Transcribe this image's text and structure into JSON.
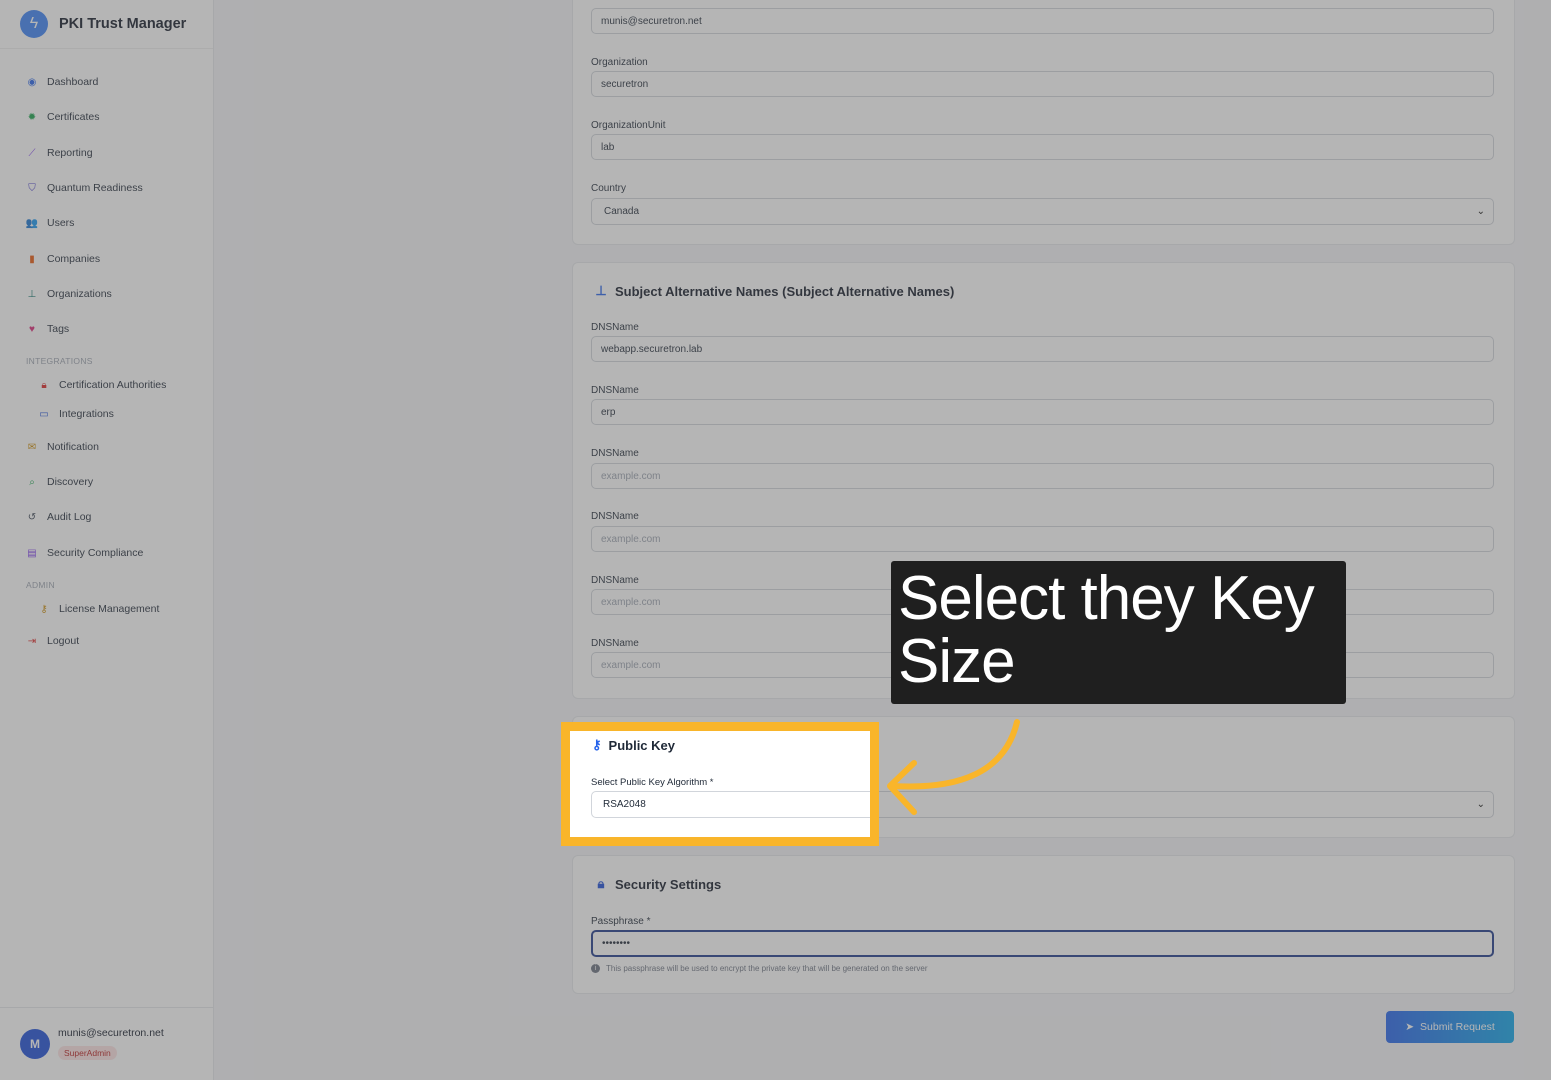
{
  "app": {
    "name": "PKI Trust Manager"
  },
  "sidebar": {
    "items": [
      {
        "label": "Dashboard",
        "icon": "dashboard-icon"
      },
      {
        "label": "Certificates",
        "icon": "certificate-icon"
      },
      {
        "label": "Reporting",
        "icon": "chart-icon"
      },
      {
        "label": "Quantum Readiness",
        "icon": "shield-icon"
      },
      {
        "label": "Users",
        "icon": "users-icon"
      },
      {
        "label": "Companies",
        "icon": "building-icon"
      },
      {
        "label": "Organizations",
        "icon": "sitemap-icon"
      },
      {
        "label": "Tags",
        "icon": "tag-icon"
      }
    ],
    "integrations_label": "INTEGRATIONS",
    "integrations": [
      {
        "label": "Certification Authorities",
        "icon": "lock-icon"
      },
      {
        "label": "Integrations",
        "icon": "laptop-icon"
      }
    ],
    "more_items": [
      {
        "label": "Notification",
        "icon": "envelope-icon"
      },
      {
        "label": "Discovery",
        "icon": "search-icon"
      },
      {
        "label": "Audit Log",
        "icon": "history-icon"
      },
      {
        "label": "Security Compliance",
        "icon": "clipboard-icon"
      }
    ],
    "admin_label": "ADMIN",
    "admin": [
      {
        "label": "License Management",
        "icon": "key-icon"
      }
    ],
    "logout": {
      "label": "Logout",
      "icon": "logout-icon"
    }
  },
  "user": {
    "initial": "M",
    "email": "munis@securetron.net",
    "role": "SuperAdmin"
  },
  "subject": {
    "email_value": "munis@securetron.net",
    "organization_label": "Organization",
    "organization_value": "securetron",
    "org_unit_label": "OrganizationUnit",
    "org_unit_value": "lab",
    "country_label": "Country",
    "country_value": "Canada"
  },
  "san": {
    "title": "Subject Alternative Names (Subject Alternative Names)",
    "fields": [
      {
        "label": "DNSName",
        "value": "webapp.securetron.lab",
        "placeholder": "example.com"
      },
      {
        "label": "DNSName",
        "value": "erp",
        "placeholder": "example.com"
      },
      {
        "label": "DNSName",
        "value": "",
        "placeholder": "example.com"
      },
      {
        "label": "DNSName",
        "value": "",
        "placeholder": "example.com"
      },
      {
        "label": "DNSName",
        "value": "",
        "placeholder": "example.com"
      },
      {
        "label": "DNSName",
        "value": "",
        "placeholder": "example.com"
      }
    ]
  },
  "public_key": {
    "title": "Public Key",
    "algorithm_label": "Select Public Key Algorithm *",
    "algorithm_value": "RSA2048"
  },
  "security": {
    "title": "Security Settings",
    "passphrase_label": "Passphrase *",
    "passphrase_value": "••••••••",
    "hint": "This passphrase will be used to encrypt the private key that will be generated on the server"
  },
  "submit_label": "Submit Request",
  "tooltip": {
    "text": "Select they Key Size"
  },
  "colors": {
    "highlight": "#f9b52a",
    "accent": "#2563eb"
  }
}
